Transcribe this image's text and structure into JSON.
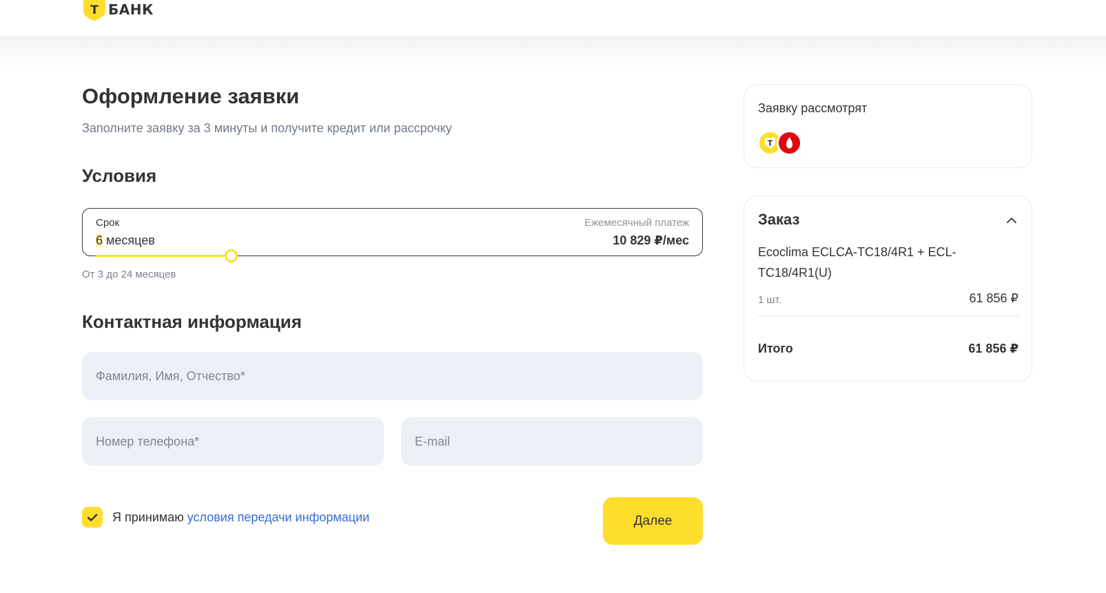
{
  "header": {
    "logo_text": "БАНК",
    "logo_letter": "Т"
  },
  "page": {
    "title": "Оформление заявки",
    "subtitle": "Заполните заявку за 3 минуты и получите кредит или рассрочку"
  },
  "conditions": {
    "section_title": "Условия",
    "term_label": "Срок",
    "term_number": "6",
    "term_unit": " месяцев",
    "payment_label": "Ежемесячный платеж",
    "payment_value": "10 829 ₽/мес",
    "term_hint": "От 3 до 24 месяцев",
    "slider": {
      "min": 3,
      "max": 24,
      "value": 6
    }
  },
  "contact": {
    "section_title": "Контактная информация",
    "fullname_placeholder": "Фамилия, Имя, Отчество*",
    "phone_placeholder": "Номер телефона*",
    "email_placeholder": "E-mail"
  },
  "consent": {
    "checked": true,
    "text": "Я принимаю ",
    "link_text": "условия передачи информации"
  },
  "next_button_label": "Далее",
  "review_card": {
    "title": "Заявку рассмотрят",
    "banks": [
      {
        "name": "tbank-icon",
        "color": "#ffdd2d",
        "letter": "Т"
      },
      {
        "name": "mts-bank-icon",
        "color": "#e30611",
        "letter": ""
      }
    ]
  },
  "order_card": {
    "title": "Заказ",
    "product_name": "Ecoclima ECLCA-TC18/4R1 + ECL-TC18/4R1(U)",
    "quantity": "1 шт.",
    "price": "61 856 ₽",
    "total_label": "Итого",
    "total_value": "61 856 ₽"
  },
  "colors": {
    "accent": "#ffdd2d",
    "link": "#3a6bd6",
    "input_bg": "#eceff5"
  }
}
